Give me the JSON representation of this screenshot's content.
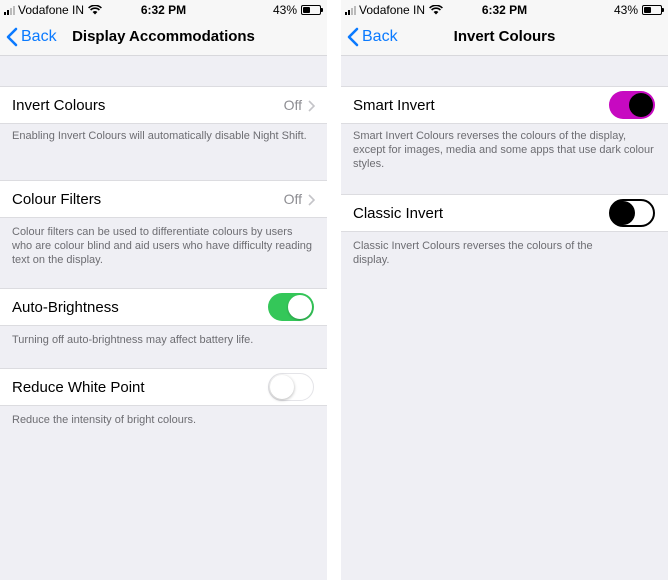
{
  "colors": {
    "accent": "#0a7aff",
    "toggle_on_green": "#34c759",
    "toggle_on_magenta": "#c709c1",
    "background": "#efeff4"
  },
  "left": {
    "status": {
      "carrier": "Vodafone IN",
      "time": "6:32 PM",
      "battery": "43%",
      "battery_level": 0.43
    },
    "nav": {
      "back_label": "Back",
      "title": "Display Accommodations"
    },
    "rows": {
      "invert_colours": {
        "label": "Invert Colours",
        "value": "Off",
        "footer": "Enabling Invert Colours will automatically disable Night Shift."
      },
      "colour_filters": {
        "label": "Colour Filters",
        "value": "Off",
        "footer": "Colour filters can be used to differentiate colours by users who are colour blind and aid users who have difficulty reading text on the display."
      },
      "auto_brightness": {
        "label": "Auto-Brightness",
        "state": "on",
        "footer": "Turning off auto-brightness may affect battery life."
      },
      "reduce_white_point": {
        "label": "Reduce White Point",
        "state": "off",
        "footer": "Reduce the intensity of bright colours."
      }
    }
  },
  "right": {
    "status": {
      "carrier": "Vodafone IN",
      "time": "6:32 PM",
      "battery": "43%",
      "battery_level": 0.43
    },
    "nav": {
      "back_label": "Back",
      "title": "Invert Colours"
    },
    "rows": {
      "smart_invert": {
        "label": "Smart Invert",
        "state": "on",
        "footer": "Smart Invert Colours reverses the colours of the display, except for images, media and some apps that use dark colour styles."
      },
      "classic_invert": {
        "label": "Classic Invert",
        "state": "off",
        "footer": "Classic Invert Colours reverses the colours of the display."
      }
    }
  }
}
